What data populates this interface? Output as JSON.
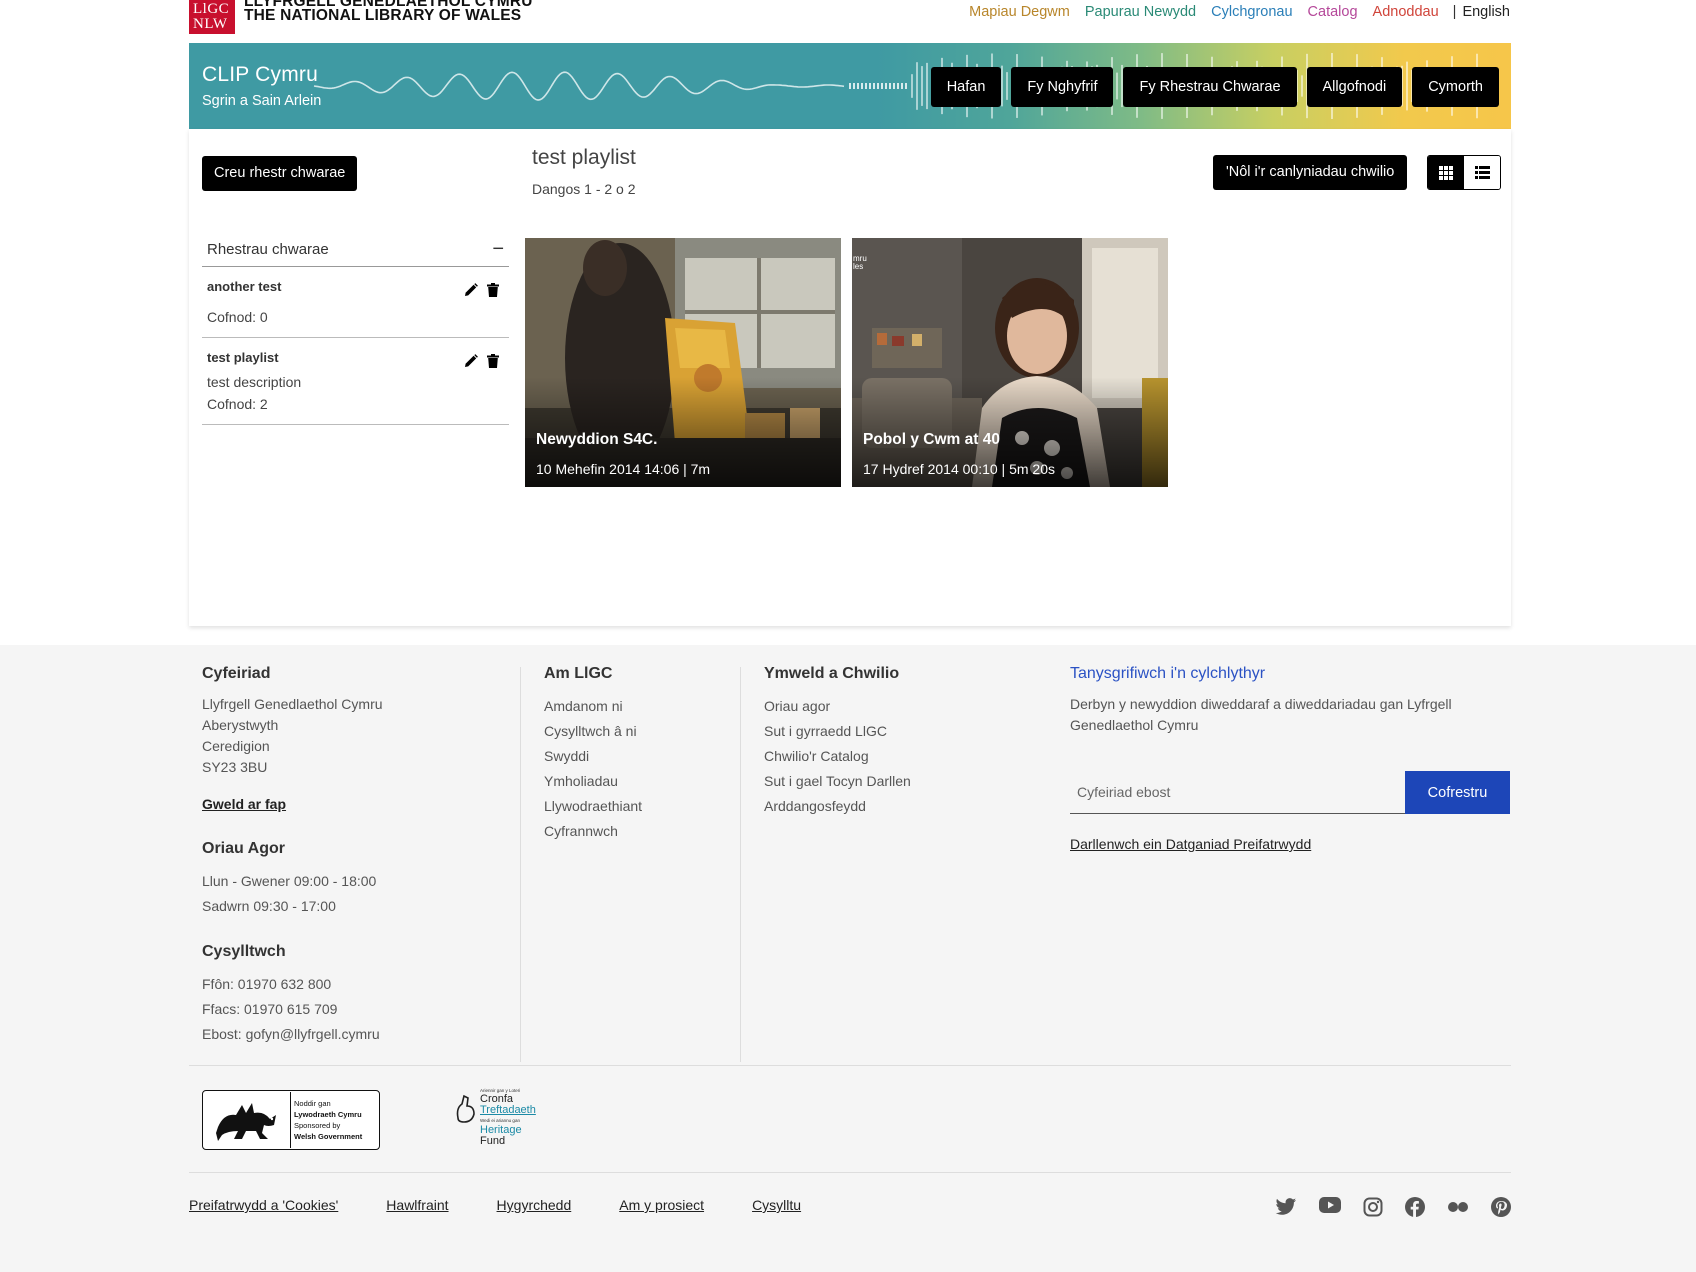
{
  "header": {
    "logo": {
      "box_line1": "LlGC",
      "box_line2": "NLW",
      "name_cy": "LLYFRGELL GENEDLAETHOL CYMRU",
      "name_en": "THE NATIONAL LIBRARY OF WALES"
    },
    "top_links": [
      {
        "label": "Mapiau Degwm",
        "color": "#b8862b"
      },
      {
        "label": "Papurau Newydd",
        "color": "#2a8a76"
      },
      {
        "label": "Cylchgronau",
        "color": "#2b7fb8"
      },
      {
        "label": "Catalog",
        "color": "#b5489a"
      },
      {
        "label": "Adnoddau",
        "color": "#d0443a"
      }
    ],
    "lang_separator": "|",
    "lang_link": "English",
    "site_title": "CLIP Cymru",
    "site_subtitle": "Sgrin a Sain Arlein",
    "nav": [
      "Hafan",
      "Fy Nghyfrif",
      "Fy Rhestrau Chwarae",
      "Allgofnodi",
      "Cymorth"
    ]
  },
  "main": {
    "create_button": "Creu rhestr chwarae",
    "playlist_title": "test playlist",
    "showing": "Dangos 1 - 2 o 2",
    "back_button": "'Nôl i'r canlyniadau chwilio",
    "view_mode": "grid",
    "sidebar": {
      "heading": "Rhestrau chwarae",
      "collapse_symbol": "−",
      "items": [
        {
          "name": "another test",
          "description": "",
          "count": "Cofnod: 0"
        },
        {
          "name": "test playlist",
          "description": "test description",
          "count": "Cofnod: 2"
        }
      ]
    },
    "cards": [
      {
        "title": "Newyddion S4C.",
        "meta": "10 Mehefin 2014 14:06 | 7m"
      },
      {
        "title": "Pobol y Cwm at 40",
        "meta": "17 Hydref 2014 00:10 | 5m 20s",
        "corner_text": "mru\nles"
      }
    ]
  },
  "footer": {
    "address": {
      "heading": "Cyfeiriad",
      "lines": [
        "Llyfrgell Genedlaethol Cymru",
        "Aberystwyth",
        "Ceredigion",
        "SY23 3BU"
      ],
      "map_link": "Gweld ar fap"
    },
    "hours": {
      "heading": "Oriau Agor",
      "lines": [
        "Llun - Gwener 09:00 - 18:00",
        "Sadwrn 09:30 - 17:00"
      ]
    },
    "contact": {
      "heading": "Cysylltwch",
      "lines": [
        "Ffôn: 01970 632 800",
        "Ffacs: 01970 615 709",
        "Ebost: gofyn@llyfrgell.cymru"
      ]
    },
    "about": {
      "heading": "Am LlGC",
      "links": [
        "Amdanom ni",
        "Cysylltwch â ni",
        "Swyddi",
        "Ymholiadau",
        "Llywodraethiant",
        "Cyfrannwch"
      ]
    },
    "visit": {
      "heading": "Ymweld a Chwilio",
      "links": [
        "Oriau agor",
        "Sut i gyrraedd LlGC",
        "Chwilio'r Catalog",
        "Sut i gael Tocyn Darllen",
        "Arddangosfeydd"
      ]
    },
    "newsletter": {
      "heading": "Tanysgrifiwch i'n cylchlythyr",
      "text": "Derbyn y newyddion diweddaraf a diweddariadau gan Lyfrgell Genedlaethol Cymru",
      "email_placeholder": "Cyfeiriad ebost",
      "email_value": "",
      "button": "Cofrestru",
      "privacy_link": "Darllenwch ein Datganiad Preifatrwydd"
    },
    "sponsors": {
      "welsh_gov": {
        "l1": "Noddir gan",
        "l2": "Lywodraeth Cymru",
        "l3": "Sponsored by",
        "l4": "Welsh Government"
      },
      "heritage": {
        "small": "Ariennir gan y Loteri",
        "l1": "Cronfa",
        "l2": "Treftadaeth",
        "small2": "Wedi ei ariannu gan",
        "l3": "Heritage",
        "l4": "Fund"
      }
    },
    "bottom_links": [
      "Preifatrwydd a 'Cookies'",
      "Hawlfraint",
      "Hygyrchedd",
      "Am y prosiect",
      "Cysylltu"
    ],
    "social_icons": [
      "twitter-icon",
      "youtube-icon",
      "instagram-icon",
      "facebook-icon",
      "flickr-icon",
      "pinterest-icon"
    ]
  }
}
